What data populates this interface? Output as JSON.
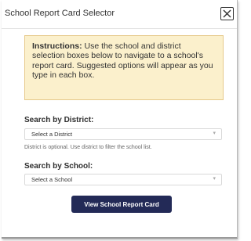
{
  "dialog": {
    "title": "School Report Card Selector"
  },
  "instructions": {
    "heading": "Instructions:",
    "body": "Use the school and district selection boxes below to navigate to a school's report card. Suggested options will appear as you type in each box."
  },
  "district": {
    "label": "Search by District:",
    "selected": "Select a District",
    "help": "District is optional. Use district to filter the school list."
  },
  "school": {
    "label": "Search by School:",
    "selected": "Select a School"
  },
  "actions": {
    "submit_label": "View School Report Card"
  },
  "icons": {
    "close": "close-icon",
    "dropdown": "chevron-down-icon"
  },
  "colors": {
    "instructions_bg": "#fbf0cc",
    "instructions_border": "#e6c98a",
    "button_bg": "#232a57"
  }
}
